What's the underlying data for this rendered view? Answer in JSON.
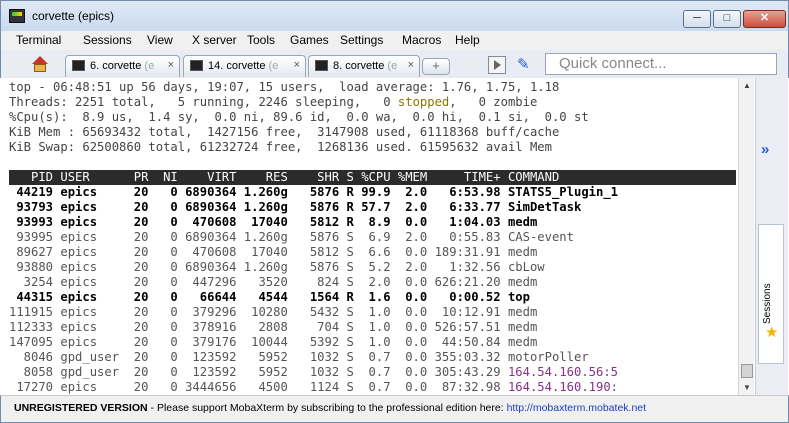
{
  "window": {
    "title": "corvette (epics)",
    "min_label": "─",
    "max_label": "□",
    "close_label": "✕"
  },
  "menu": [
    "Terminal",
    "Sessions",
    "View",
    "X server",
    "Tools",
    "Games",
    "Settings",
    "Macros",
    "Help"
  ],
  "tabs": [
    {
      "label": "6. corvette",
      "dim": " (e",
      "close": "×"
    },
    {
      "label": "14. corvette",
      "dim": " (e",
      "close": "×"
    },
    {
      "label": "8. corvette",
      "dim": " (e",
      "close": "×"
    }
  ],
  "new_tab_label": "+",
  "quick_connect_placeholder": "Quick connect...",
  "terminal": {
    "summary": [
      "top - 06:48:51 up 56 days, 19:07, 15 users,  load average: 1.76, 1.75, 1.18",
      "Threads: 2251 total,   5 running, 2246 sleeping,   0 stopped,   0 zombie",
      "%Cpu(s):  8.9 us,  1.4 sy,  0.0 ni, 89.6 id,  0.0 wa,  0.0 hi,  0.1 si,  0.0 st",
      "KiB Mem : 65693432 total,  1427156 free,  3147908 used, 61118368 buff/cache",
      "KiB Swap: 62500860 total, 61232724 free,  1268136 used. 61595632 avail Mem"
    ],
    "threads_prefix": "Threads: 2251 total,   5 running, 2246 sleeping,   0 ",
    "threads_stopped": "stopped",
    "threads_suffix": ",   0 zombie",
    "header": "   PID USER      PR  NI    VIRT    RES    SHR S %CPU %MEM     TIME+ COMMAND",
    "processes": [
      {
        "text": " 44219 epics     20   0 6890364 1.260g   5876 R 99.9  2.0   6:53.98 STATS5_Plugin_1",
        "bold": true
      },
      {
        "text": " 93793 epics     20   0 6890364 1.260g   5876 R 57.7  2.0   6:33.77 SimDetTask",
        "bold": true
      },
      {
        "text": " 93993 epics     20   0  470608  17040   5812 R  8.9  0.0   1:04.03 medm",
        "bold": true
      },
      {
        "text": " 93995 epics     20   0 6890364 1.260g   5876 S  6.9  2.0   0:55.83 CAS-event",
        "bold": false
      },
      {
        "text": " 89627 epics     20   0  470608  17040   5812 S  6.6  0.0 189:31.91 medm",
        "bold": false
      },
      {
        "text": " 93880 epics     20   0 6890364 1.260g   5876 S  5.2  2.0   1:32.56 cbLow",
        "bold": false
      },
      {
        "text": "  3254 epics     20   0  447296   3520    824 S  2.0  0.0 626:21.20 medm",
        "bold": false
      },
      {
        "text": " 44315 epics     20   0   66644   4544   1564 R  1.6  0.0   0:00.52 top",
        "bold": true
      },
      {
        "text": "111915 epics     20   0  379296  10280   5432 S  1.0  0.0  10:12.91 medm",
        "bold": false
      },
      {
        "text": "112333 epics     20   0  378916   2808    704 S  1.0  0.0 526:57.51 medm",
        "bold": false
      },
      {
        "text": "147095 epics     20   0  379176  10044   5392 S  1.0  0.0  44:50.84 medm",
        "bold": false
      },
      {
        "text": "  8046 gpd_user  20   0  123592   5952   1032 S  0.7  0.0 355:03.32 motorPoller",
        "bold": false
      },
      {
        "text": "  8058 gpd_user  20   0  123592   5952   1032 S  0.7  0.0 305:43.29 ",
        "extra": "164.54.160.56:5",
        "bold": false
      },
      {
        "text": " 17270 epics     20   0 3444656   4500   1124 S  0.7  0.0  87:32.98 ",
        "extra": "164.54.160.190:",
        "bold": false
      }
    ]
  },
  "side_panel": {
    "chevron": "»",
    "sessions_label": "Sessions",
    "star": "★"
  },
  "footer": {
    "unregistered": "UNREGISTERED VERSION",
    "message": "  -  Please support MobaXterm by subscribing to the professional edition here:  ",
    "link": "http://mobaxterm.mobatek.net"
  }
}
